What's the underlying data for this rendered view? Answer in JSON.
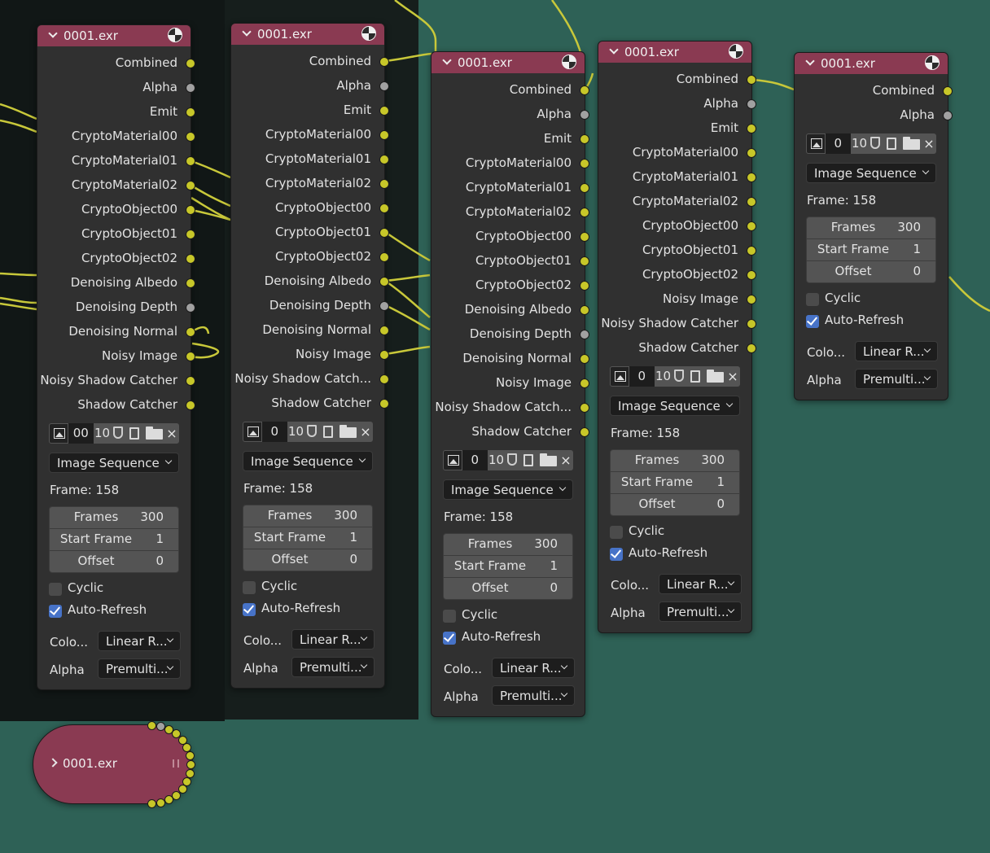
{
  "colors": {
    "canvas": "#2e6156",
    "frame": "#161e1c",
    "node_body": "#303030",
    "node_header": "#8a3a52",
    "socket_color": "#c7c729",
    "socket_alpha": "#a1a1a1",
    "wire": "#c8c83a",
    "checkbox_on": "#4773c8"
  },
  "icons": {
    "header": "render-preview-icon",
    "toolbar": [
      "image-browse-icon",
      "fake-user-shield-icon",
      "copy-icon",
      "folder-icon",
      "close-icon"
    ]
  },
  "nodes": [
    {
      "title": "0001.exr",
      "sockets": [
        {
          "label": "Combined",
          "type": "color"
        },
        {
          "label": "Alpha",
          "type": "alpha"
        },
        {
          "label": "Emit",
          "type": "color"
        },
        {
          "label": "CryptoMaterial00",
          "type": "color"
        },
        {
          "label": "CryptoMaterial01",
          "type": "color"
        },
        {
          "label": "CryptoMaterial02",
          "type": "color"
        },
        {
          "label": "CryptoObject00",
          "type": "color"
        },
        {
          "label": "CryptoObject01",
          "type": "color"
        },
        {
          "label": "CryptoObject02",
          "type": "color"
        },
        {
          "label": "Denoising Albedo",
          "type": "color"
        },
        {
          "label": "Denoising Depth",
          "type": "alpha"
        },
        {
          "label": "Denoising Normal",
          "type": "color"
        },
        {
          "label": "Noisy Image",
          "type": "color"
        },
        {
          "label": "Noisy Shadow Catcher",
          "type": "color"
        },
        {
          "label": "Shadow Catcher",
          "type": "color"
        }
      ],
      "image_name": "00",
      "users": "10",
      "source": "Image Sequence",
      "frame_text": "Frame: 158",
      "frames_label": "Frames",
      "frames": "300",
      "start_label": "Start Frame",
      "start": "1",
      "offset_label": "Offset",
      "offset": "0",
      "cyclic_label": "Cyclic",
      "cyclic": false,
      "autorefresh_label": "Auto-Refresh",
      "autorefresh": true,
      "color_label": "Colo...",
      "color_value": "Linear R...",
      "alpha_label": "Alpha",
      "alpha_value": "Premulti..."
    },
    {
      "title": "0001.exr",
      "sockets": [
        {
          "label": "Combined",
          "type": "color"
        },
        {
          "label": "Alpha",
          "type": "alpha"
        },
        {
          "label": "Emit",
          "type": "color"
        },
        {
          "label": "CryptoMaterial00",
          "type": "color"
        },
        {
          "label": "CryptoMaterial01",
          "type": "color"
        },
        {
          "label": "CryptoMaterial02",
          "type": "color"
        },
        {
          "label": "CryptoObject00",
          "type": "color"
        },
        {
          "label": "CryptoObject01",
          "type": "color"
        },
        {
          "label": "CryptoObject02",
          "type": "color"
        },
        {
          "label": "Denoising Albedo",
          "type": "color"
        },
        {
          "label": "Denoising Depth",
          "type": "alpha"
        },
        {
          "label": "Denoising Normal",
          "type": "color"
        },
        {
          "label": "Noisy Image",
          "type": "color"
        },
        {
          "label": "Noisy Shadow Catch...",
          "type": "color"
        },
        {
          "label": "Shadow Catcher",
          "type": "color"
        }
      ],
      "image_name": "0",
      "users": "10",
      "source": "Image Sequence",
      "frame_text": "Frame: 158",
      "frames_label": "Frames",
      "frames": "300",
      "start_label": "Start Frame",
      "start": "1",
      "offset_label": "Offset",
      "offset": "0",
      "cyclic_label": "Cyclic",
      "cyclic": false,
      "autorefresh_label": "Auto-Refresh",
      "autorefresh": true,
      "color_label": "Colo...",
      "color_value": "Linear R...",
      "alpha_label": "Alpha",
      "alpha_value": "Premulti..."
    },
    {
      "title": "0001.exr",
      "sockets": [
        {
          "label": "Combined",
          "type": "color"
        },
        {
          "label": "Alpha",
          "type": "alpha"
        },
        {
          "label": "Emit",
          "type": "color"
        },
        {
          "label": "CryptoMaterial00",
          "type": "color"
        },
        {
          "label": "CryptoMaterial01",
          "type": "color"
        },
        {
          "label": "CryptoMaterial02",
          "type": "color"
        },
        {
          "label": "CryptoObject00",
          "type": "color"
        },
        {
          "label": "CryptoObject01",
          "type": "color"
        },
        {
          "label": "CryptoObject02",
          "type": "color"
        },
        {
          "label": "Denoising Albedo",
          "type": "color"
        },
        {
          "label": "Denoising Depth",
          "type": "alpha"
        },
        {
          "label": "Denoising Normal",
          "type": "color"
        },
        {
          "label": "Noisy Image",
          "type": "color"
        },
        {
          "label": "Noisy Shadow Catch...",
          "type": "color"
        },
        {
          "label": "Shadow Catcher",
          "type": "color"
        }
      ],
      "image_name": "0",
      "users": "10",
      "source": "Image Sequence",
      "frame_text": "Frame: 158",
      "frames_label": "Frames",
      "frames": "300",
      "start_label": "Start Frame",
      "start": "1",
      "offset_label": "Offset",
      "offset": "0",
      "cyclic_label": "Cyclic",
      "cyclic": false,
      "autorefresh_label": "Auto-Refresh",
      "autorefresh": true,
      "color_label": "Colo...",
      "color_value": "Linear R...",
      "alpha_label": "Alpha",
      "alpha_value": "Premulti..."
    },
    {
      "title": "0001.exr",
      "sockets": [
        {
          "label": "Combined",
          "type": "color"
        },
        {
          "label": "Alpha",
          "type": "alpha"
        },
        {
          "label": "Emit",
          "type": "color"
        },
        {
          "label": "CryptoMaterial00",
          "type": "color"
        },
        {
          "label": "CryptoMaterial01",
          "type": "color"
        },
        {
          "label": "CryptoMaterial02",
          "type": "color"
        },
        {
          "label": "CryptoObject00",
          "type": "color"
        },
        {
          "label": "CryptoObject01",
          "type": "color"
        },
        {
          "label": "CryptoObject02",
          "type": "color"
        },
        {
          "label": "Noisy Image",
          "type": "color"
        },
        {
          "label": "Noisy Shadow Catcher",
          "type": "color"
        },
        {
          "label": "Shadow Catcher",
          "type": "color"
        }
      ],
      "image_name": "0",
      "users": "10",
      "source": "Image Sequence",
      "frame_text": "Frame: 158",
      "frames_label": "Frames",
      "frames": "300",
      "start_label": "Start Frame",
      "start": "1",
      "offset_label": "Offset",
      "offset": "0",
      "cyclic_label": "Cyclic",
      "cyclic": false,
      "autorefresh_label": "Auto-Refresh",
      "autorefresh": true,
      "color_label": "Colo...",
      "color_value": "Linear R...",
      "alpha_label": "Alpha",
      "alpha_value": "Premulti..."
    },
    {
      "title": "0001.exr",
      "sockets": [
        {
          "label": "Combined",
          "type": "color"
        },
        {
          "label": "Alpha",
          "type": "alpha"
        }
      ],
      "image_name": "0",
      "users": "10",
      "source": "Image Sequence",
      "frame_text": "Frame: 158",
      "frames_label": "Frames",
      "frames": "300",
      "start_label": "Start Frame",
      "start": "1",
      "offset_label": "Offset",
      "offset": "0",
      "cyclic_label": "Cyclic",
      "cyclic": false,
      "autorefresh_label": "Auto-Refresh",
      "autorefresh": true,
      "color_label": "Colo...",
      "color_value": "Linear R...",
      "alpha_label": "Alpha",
      "alpha_value": "Premulti..."
    }
  ],
  "collapsed_node": {
    "title": "0001.exr",
    "socket_types": [
      "color",
      "alpha",
      "color",
      "color",
      "color",
      "color",
      "color",
      "color",
      "color",
      "color",
      "color",
      "color",
      "color",
      "color",
      "color"
    ]
  }
}
